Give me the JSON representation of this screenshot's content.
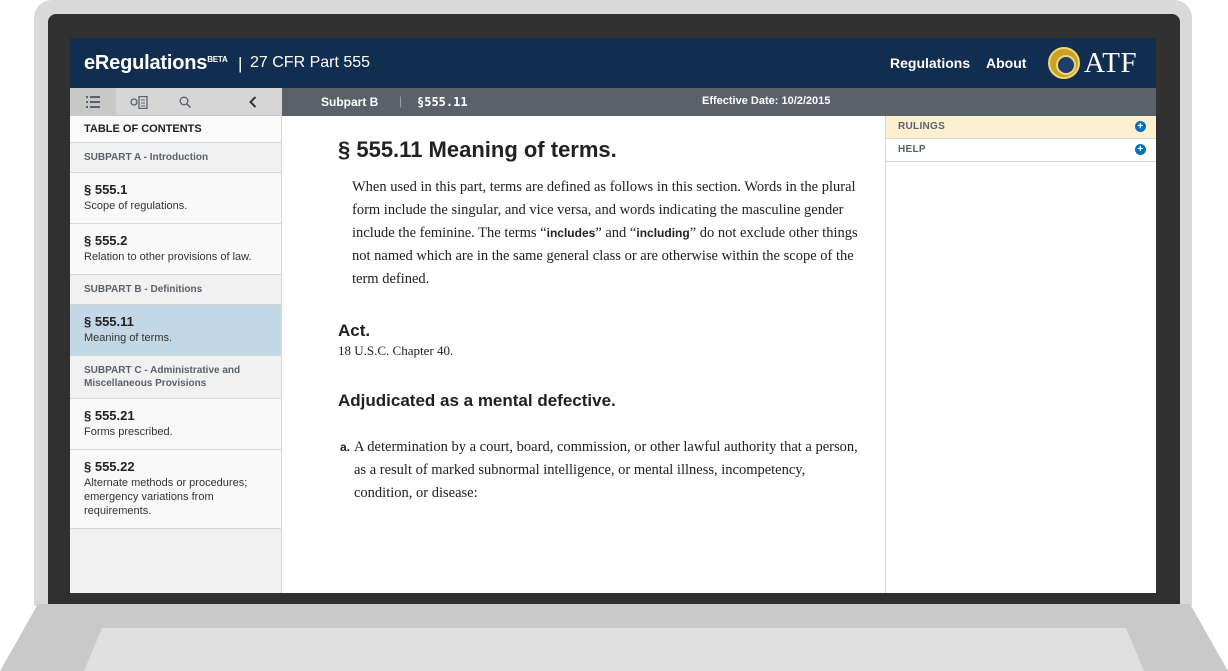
{
  "header": {
    "brand": "eRegulations",
    "brand_sup": "BETA",
    "separator": "|",
    "part": "27 CFR Part 555",
    "nav": [
      "Regulations",
      "About"
    ],
    "logo_text": "ATF"
  },
  "sidebar": {
    "tabs": [
      "table-of-contents-icon",
      "history-icon",
      "search-icon",
      "collapse-icon"
    ],
    "toc_title": "TABLE OF CONTENTS",
    "subpart_a": "SUBPART A - Introduction",
    "item1": {
      "num": "§ 555.1",
      "desc": "Scope of regulations."
    },
    "item2": {
      "num": "§ 555.2",
      "desc": "Relation to other provisions of law."
    },
    "subpart_b": "SUBPART B - Definitions",
    "item3": {
      "num": "§ 555.11",
      "desc": "Meaning of terms."
    },
    "subpart_c": "SUBPART C - Administrative and Miscellaneous Provisions",
    "item4": {
      "num": "§ 555.21",
      "desc": "Forms prescribed."
    },
    "item5": {
      "num": "§ 555.22",
      "desc": "Alternate methods or procedures; emergency variations from requirements."
    }
  },
  "subheader": {
    "subpart": "Subpart B",
    "pipe": "|",
    "section": "§555.11",
    "effective": "Effective Date: 10/2/2015"
  },
  "content": {
    "title": "§ 555.11 Meaning of terms.",
    "intro_a": "When used in this part, terms are defined as follows in this section. Words in the plural form include the singular, and vice versa, and words indicating the masculine gender include the feminine. The terms “",
    "intro_kw1": "includes",
    "intro_b": "” and “",
    "intro_kw2": "including",
    "intro_c": "” do not exclude other things not named which are in the same general class or are otherwise within the scope of the term defined.",
    "def1_title": "Act.",
    "def1_text": "18 U.S.C. Chapter 40.",
    "def2_title": "Adjudicated as a mental defective.",
    "list_marker": "a.",
    "list_a": "A determination by a court, board, commission, or other lawful authority that a person, as a result of marked subnormal intelligence, or mental illness, incompetency, condition, or disease:"
  },
  "right_panel": {
    "rulings": "RULINGS",
    "help": "HELP",
    "plus": "+"
  },
  "colors": {
    "header_bg": "#112e51",
    "subheader_bg": "#5b616b",
    "active_item": "#c2d8e6",
    "rulings_highlight": "#fdf0d0",
    "plus_icon": "#0071bc"
  }
}
